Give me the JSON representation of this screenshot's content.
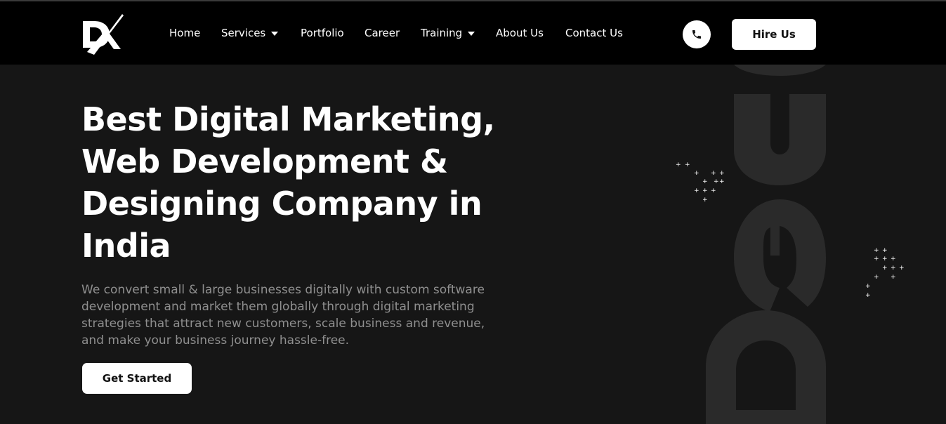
{
  "brand": {
    "logo_icon": "dx-logo-icon"
  },
  "nav": {
    "items": [
      {
        "label": "Home",
        "has_caret": false
      },
      {
        "label": "Services",
        "has_caret": true
      },
      {
        "label": "Portfolio",
        "has_caret": false
      },
      {
        "label": "Career",
        "has_caret": false
      },
      {
        "label": "Training",
        "has_caret": true
      },
      {
        "label": "About Us",
        "has_caret": false
      },
      {
        "label": "Contact Us",
        "has_caret": false
      }
    ],
    "phone_icon": "phone-icon",
    "hire_label": "Hire Us"
  },
  "hero": {
    "title_lines": [
      "Best Digital Marketing,",
      "Web Development &",
      "Designing Company in",
      "India"
    ],
    "description": "We convert small & large businesses digitally with custom software development and market them globally through digital marketing strategies that attract new customers, scale business and revenue, and make your business journey hassle-free.",
    "cta_label": "Get Started"
  },
  "colors": {
    "nav_bg": "#000000",
    "hero_bg": "#161616",
    "text": "#ffffff",
    "muted": "#8f8f8f",
    "watermark": "#2a2a2a"
  }
}
